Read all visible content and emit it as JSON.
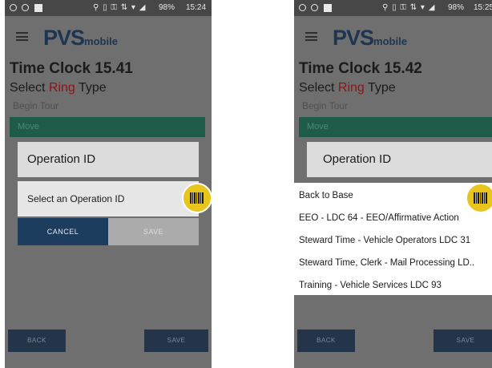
{
  "left_screen": {
    "status": {
      "glyphs": "⚲ ▯ ⚿ ⇅ ▾ ◢",
      "battery": "98%",
      "time": "15:24"
    },
    "logo": {
      "main": "PVS",
      "suffix": "mobile"
    },
    "title": "Time Clock 15.41",
    "select_ring": {
      "prefix": "Select ",
      "highlight": "Ring",
      "suffix": " Type"
    },
    "begin_tour": "Begin Tour",
    "selected_item": "Move",
    "dialog": {
      "title": "Operation ID",
      "select_text": "Select an Operation ID",
      "cancel": "CANCEL",
      "save": "SAVE"
    },
    "footer": {
      "back": "BACK",
      "save": "SAVE"
    }
  },
  "right_screen": {
    "status": {
      "glyphs": "⚲ ▯ ⚿ ⇅ ▾ ◢",
      "battery": "98%",
      "time": "15:25"
    },
    "logo": {
      "main": "PVS",
      "suffix": "mobile"
    },
    "title": "Time Clock 15.42",
    "select_ring": {
      "prefix": "Select ",
      "highlight": "Ring",
      "suffix": " Type"
    },
    "begin_tour": "Begin Tour",
    "selected_item": "Move",
    "dialog": {
      "title": "Operation ID"
    },
    "options": [
      "Back to Base",
      "EEO - LDC 64 - EEO/Affirmative Action",
      "Steward Time - Vehicle Operators LDC 31",
      "Steward Time, Clerk - Mail Processing LD..",
      "Training - Vehicle Services LDC 93"
    ],
    "footer": {
      "back": "BACK",
      "save": "SAVE"
    }
  },
  "colors": {
    "accent_yellow": "#e8c51c",
    "navy": "#1d3d5f",
    "teal": "#1e5c49",
    "ring_red": "#8c1414"
  },
  "icons": [
    "menu-icon",
    "barcode-icon",
    "battery-icon",
    "wifi-icon",
    "signal-icon"
  ]
}
